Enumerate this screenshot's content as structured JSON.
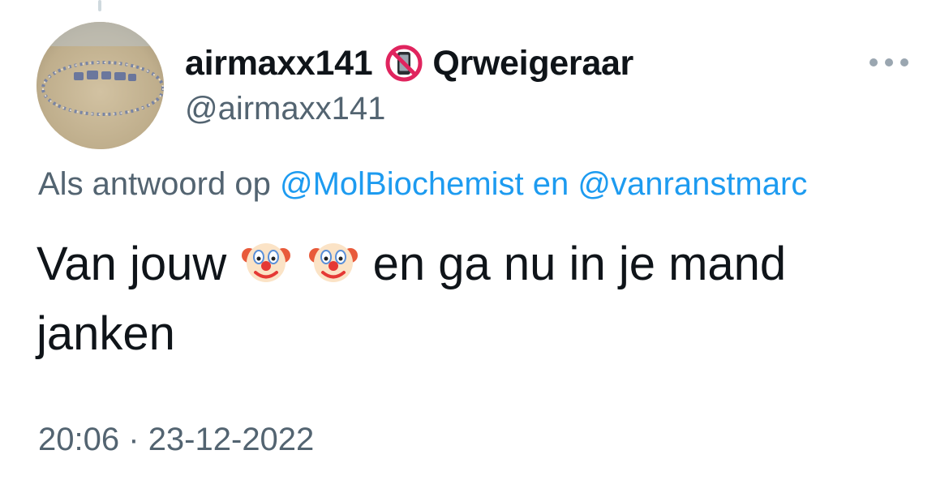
{
  "tweet": {
    "display_name": "airmaxx141",
    "name_suffix": "Qrweigeraar",
    "handle": "@airmaxx141",
    "reply_prefix": "Als antwoord op",
    "reply_mention_1": "@MolBiochemist",
    "reply_joiner": "en",
    "reply_mention_2": "@vanranstmarc",
    "text_part_1": "Van jouw",
    "text_part_2": "en ga nu in je mand janken",
    "emojis": [
      "clown-face",
      "clown-face"
    ],
    "time": "20:06",
    "separator": "·",
    "date": "23-12-2022"
  },
  "icons": {
    "name_badge": "no-mobile-phones-icon",
    "more": "more-options-icon"
  },
  "colors": {
    "text": "#0f1419",
    "secondary": "#536471",
    "link": "#1d9bf0",
    "thread_line": "#cfd9de"
  }
}
